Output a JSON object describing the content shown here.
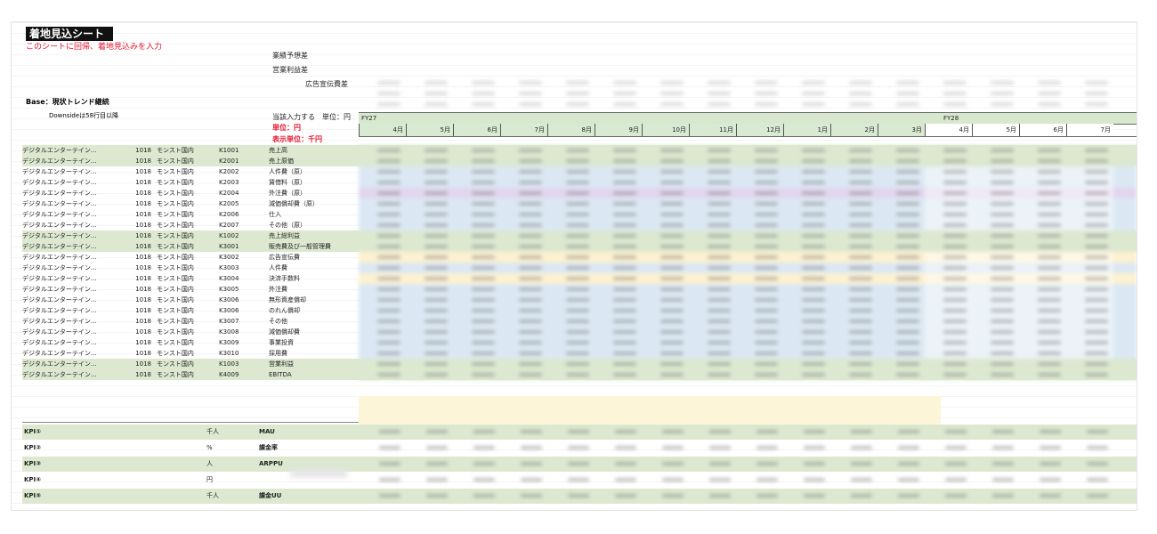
{
  "sheet": {
    "title": "着地見込シート",
    "subtitle": "このシートに回帰、着地見込みを入力",
    "header_notes": {
      "line1": "業績予想差",
      "line2": "営業利益差",
      "line3": "広告宣伝費差"
    },
    "base_label": "Base：現状トレンド継続",
    "downside_note": "Downsideは58行目以降",
    "input_label": "当該入力する　単位：円",
    "unit_label": "単位：円",
    "display_unit_label": "表示単位：千円",
    "fy27": "FY27",
    "fy28": "FY28",
    "months": [
      "4月",
      "5月",
      "6月",
      "7月",
      "8月",
      "9月",
      "10月",
      "11月",
      "12月",
      "1月",
      "2月",
      "3月",
      "4月",
      "5月",
      "6月",
      "7月"
    ]
  },
  "rows": [
    {
      "company": "デジタルエンターテイン...",
      "code": "1018",
      "segment": "モンスト国内",
      "account": "K1001",
      "name": "売上高",
      "green": true
    },
    {
      "company": "デジタルエンターテイン...",
      "code": "1018",
      "segment": "モンスト国内",
      "account": "K2001",
      "name": "売上原価",
      "green": true
    },
    {
      "company": "デジタルエンターテイン...",
      "code": "1018",
      "segment": "モンスト国内",
      "account": "K2002",
      "name": "人件費（原）",
      "green": false
    },
    {
      "company": "デジタルエンターテイン...",
      "code": "1018",
      "segment": "モンスト国内",
      "account": "K2003",
      "name": "賃借料（原）",
      "green": false
    },
    {
      "company": "デジタルエンターテイン...",
      "code": "1018",
      "segment": "モンスト国内",
      "account": "K2004",
      "name": "外注費（原）",
      "green": false
    },
    {
      "company": "デジタルエンターテイン...",
      "code": "1018",
      "segment": "モンスト国内",
      "account": "K2005",
      "name": "減価償却費（原）",
      "green": false
    },
    {
      "company": "デジタルエンターテイン...",
      "code": "1018",
      "segment": "モンスト国内",
      "account": "K2006",
      "name": "仕入",
      "green": false
    },
    {
      "company": "デジタルエンターテイン...",
      "code": "1018",
      "segment": "モンスト国内",
      "account": "K2007",
      "name": "その他（原）",
      "green": false
    },
    {
      "company": "デジタルエンターテイン...",
      "code": "1018",
      "segment": "モンスト国内",
      "account": "K1002",
      "name": "売上総利益",
      "green": true
    },
    {
      "company": "デジタルエンターテイン...",
      "code": "1018",
      "segment": "モンスト国内",
      "account": "K3001",
      "name": "販売費及び一般管理費",
      "green": true
    },
    {
      "company": "デジタルエンターテイン...",
      "code": "1018",
      "segment": "モンスト国内",
      "account": "K3002",
      "name": "広告宣伝費",
      "green": false
    },
    {
      "company": "デジタルエンターテイン...",
      "code": "1018",
      "segment": "モンスト国内",
      "account": "K3003",
      "name": "人件費",
      "green": false
    },
    {
      "company": "デジタルエンターテイン...",
      "code": "1018",
      "segment": "モンスト国内",
      "account": "K3004",
      "name": "決済手数料",
      "green": false
    },
    {
      "company": "デジタルエンターテイン...",
      "code": "1018",
      "segment": "モンスト国内",
      "account": "K3005",
      "name": "外注費",
      "green": false
    },
    {
      "company": "デジタルエンターテイン...",
      "code": "1018",
      "segment": "モンスト国内",
      "account": "K3006",
      "name": "無形資産償却",
      "green": false
    },
    {
      "company": "デジタルエンターテイン...",
      "code": "1018",
      "segment": "モンスト国内",
      "account": "K3006",
      "name": "のれん償却",
      "green": false
    },
    {
      "company": "デジタルエンターテイン...",
      "code": "1018",
      "segment": "モンスト国内",
      "account": "K3007",
      "name": "その他",
      "green": false
    },
    {
      "company": "デジタルエンターテイン...",
      "code": "1018",
      "segment": "モンスト国内",
      "account": "K3008",
      "name": "減価償却費",
      "green": false
    },
    {
      "company": "デジタルエンターテイン...",
      "code": "1018",
      "segment": "モンスト国内",
      "account": "K3009",
      "name": "事業投資",
      "green": false
    },
    {
      "company": "デジタルエンターテイン...",
      "code": "1018",
      "segment": "モンスト国内",
      "account": "K3010",
      "name": "採用費",
      "green": false
    },
    {
      "company": "デジタルエンターテイン...",
      "code": "1018",
      "segment": "モンスト国内",
      "account": "K1003",
      "name": "営業利益",
      "green": true
    },
    {
      "company": "デジタルエンターテイン...",
      "code": "1018",
      "segment": "モンスト国内",
      "account": "K4009",
      "name": "EBITDA",
      "green": true
    }
  ],
  "kpis": [
    {
      "label": "KPI①",
      "unit": "千人",
      "name": "MAU",
      "green": true
    },
    {
      "label": "KPI②",
      "unit": "%",
      "name": "課金率",
      "green": false
    },
    {
      "label": "KPI③",
      "unit": "人",
      "name": "ARPPU",
      "green": true
    },
    {
      "label": "KPI④",
      "unit": "円",
      "name": "",
      "green": false
    },
    {
      "label": "KPI⑤",
      "unit": "千人",
      "name": "課金UU",
      "green": true
    }
  ]
}
